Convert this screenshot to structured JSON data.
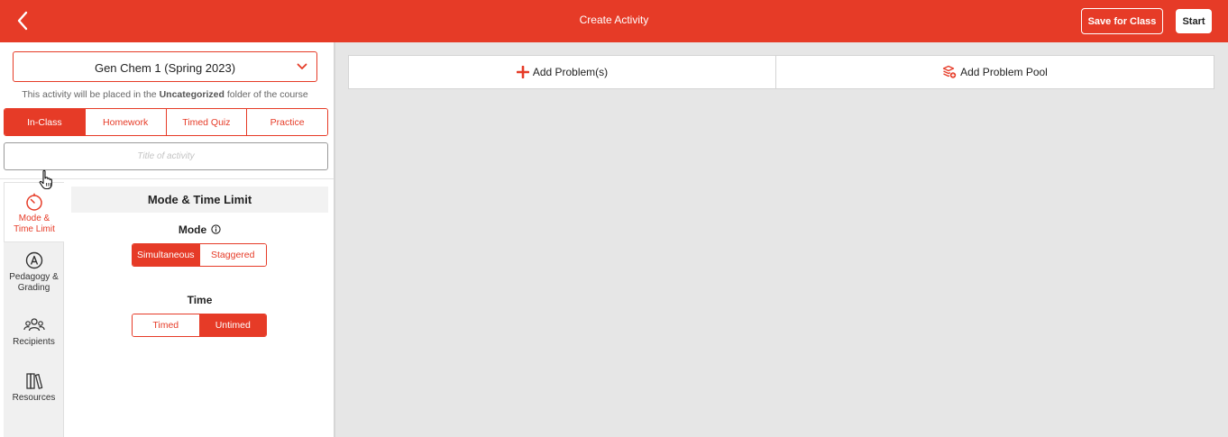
{
  "header": {
    "title": "Create Activity",
    "save_label": "Save for Class",
    "start_label": "Start",
    "back_icon": "chevron-left-icon",
    "brand_color": "#e63b27"
  },
  "course": {
    "selected": "Gen Chem 1 (Spring 2023)",
    "chevron_icon": "chevron-down-icon"
  },
  "placement": {
    "prefix": "This activity will be placed in the ",
    "folder": "Uncategorized",
    "suffix": " folder of the course"
  },
  "activity_types": {
    "items": [
      "In-Class",
      "Homework",
      "Timed Quiz",
      "Practice"
    ],
    "active": "In-Class"
  },
  "title_input": {
    "value": "",
    "placeholder": "Title of activity"
  },
  "side_nav": {
    "items": [
      {
        "label_line1": "Mode &",
        "label_line2": "Time Limit",
        "icon": "timer-icon",
        "active": true
      },
      {
        "label_line1": "Pedagogy &",
        "label_line2": "Grading",
        "icon": "compass-icon",
        "active": false
      },
      {
        "label_line1": "Recipients",
        "label_line2": "",
        "icon": "users-icon",
        "active": false
      },
      {
        "label_line1": "Resources",
        "label_line2": "",
        "icon": "books-icon",
        "active": false
      }
    ]
  },
  "mode_section": {
    "title": "Mode & Time Limit",
    "mode_label": "Mode",
    "mode_options": [
      "Simultaneous",
      "Staggered"
    ],
    "mode_selected": "Simultaneous",
    "time_label": "Time",
    "time_options": [
      "Timed",
      "Untimed"
    ],
    "time_selected": "Untimed"
  },
  "workspace": {
    "add_problem_label": "Add Problem(s)",
    "add_pool_label": "Add Problem Pool",
    "add_problem_icon": "plus-icon",
    "add_pool_icon": "stack-add-icon"
  }
}
